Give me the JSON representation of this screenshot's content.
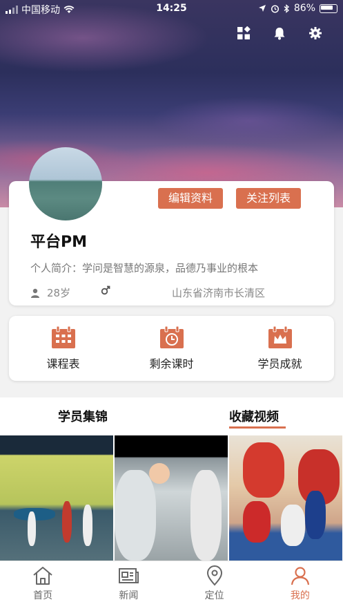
{
  "status_bar": {
    "carrier": "中国移动",
    "time": "14:25",
    "battery": "86%"
  },
  "header_icons": [
    "apps-icon",
    "bell-icon",
    "gear-icon"
  ],
  "profile": {
    "edit_label": "编辑资料",
    "follow_label": "关注列表",
    "name": "平台PM",
    "bio": "个人简介：学问是智慧的源泉，品德乃事业的根本",
    "age": "28岁",
    "gender_icon": "male-icon",
    "location": "山东省济南市长清区"
  },
  "menu": [
    {
      "label": "课程表",
      "icon": "calendar-icon"
    },
    {
      "label": "剩余课时",
      "icon": "clock-calendar-icon"
    },
    {
      "label": "学员成就",
      "icon": "crown-calendar-icon"
    }
  ],
  "tabs": {
    "items": [
      "学员集锦",
      "收藏视频"
    ],
    "active": 1
  },
  "tabbar": [
    {
      "label": "首页",
      "icon": "home-icon"
    },
    {
      "label": "新闻",
      "icon": "news-icon"
    },
    {
      "label": "定位",
      "icon": "location-icon"
    },
    {
      "label": "我的",
      "icon": "user-icon"
    }
  ],
  "tabbar_active": 3,
  "colors": {
    "accent": "#d9704f",
    "background": "#f2f2f2"
  }
}
